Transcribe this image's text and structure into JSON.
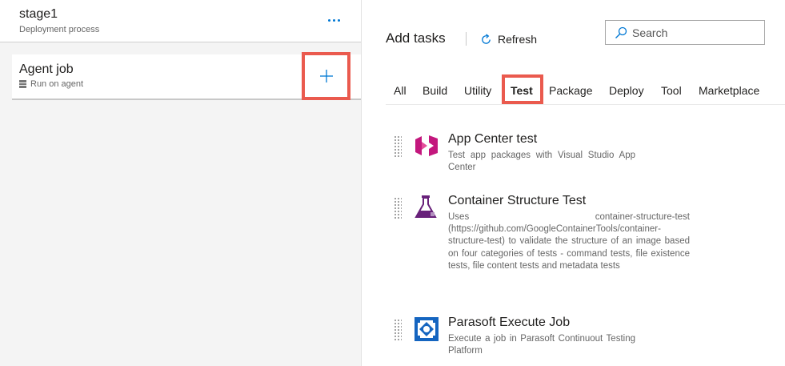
{
  "stage": {
    "title": "stage1",
    "subtitle": "Deployment process",
    "more_icon": "more-ellipsis-icon"
  },
  "agent_job": {
    "title": "Agent job",
    "subtitle": "Run on agent",
    "subtitle_icon": "server-icon",
    "add_icon": "plus-icon"
  },
  "add_tasks": {
    "title": "Add tasks",
    "refresh_label": "Refresh",
    "search_placeholder": "Search"
  },
  "tabs": [
    {
      "label": "All"
    },
    {
      "label": "Build"
    },
    {
      "label": "Utility"
    },
    {
      "label": "Test",
      "active": true
    },
    {
      "label": "Package"
    },
    {
      "label": "Deploy"
    },
    {
      "label": "Tool"
    },
    {
      "label": "Marketplace"
    }
  ],
  "tasks": [
    {
      "name": "App Center test",
      "description": "Test app packages with Visual Studio App Center",
      "icon": "visual-studio-app-center-icon"
    },
    {
      "name": "Container Structure Test",
      "description": "Uses container-structure-test (https://github.com/GoogleContainerTools/container-structure-test) to validate the structure of an image based on four categories of tests - command tests, file existence tests, file content tests and metadata tests",
      "icon": "beaker-icon"
    },
    {
      "name": "Parasoft Execute Job",
      "description": "Execute a job in Parasoft Continuout Testing Platform",
      "icon": "parasoft-icon"
    }
  ],
  "colors": {
    "accent": "#0078d4",
    "highlight": "#ea5a4e",
    "app_center": "#c3177d",
    "beaker": "#68217a",
    "parasoft": "#1565c0"
  }
}
